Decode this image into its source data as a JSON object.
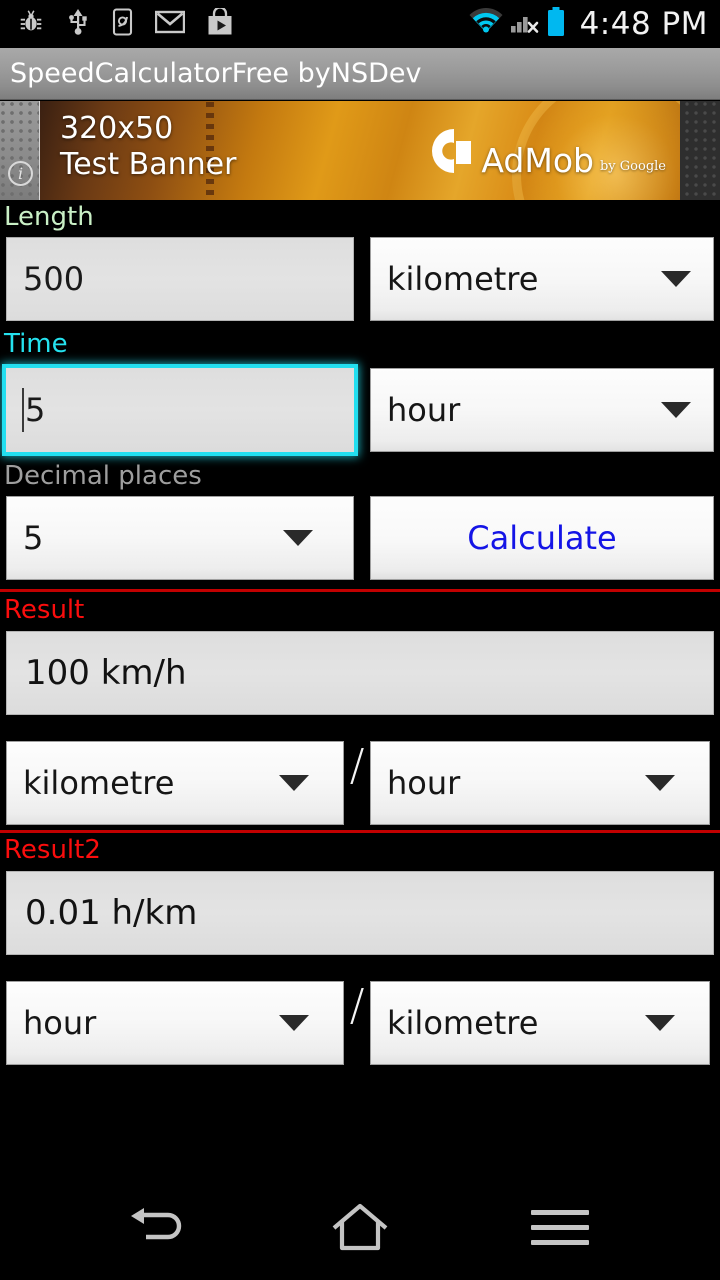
{
  "status_bar": {
    "icons": [
      "bug-icon",
      "usb-icon",
      "screen-cast-icon",
      "gmail-icon",
      "play-store-icon"
    ],
    "right_icons": [
      "wifi-icon",
      "cell-signal-no-sim-icon",
      "battery-icon"
    ],
    "clock": "4:48 PM",
    "wifi_color": "#00c8f0",
    "battery_color": "#00b8f0"
  },
  "title_bar": {
    "title": "SpeedCalculatorFree byNSDev"
  },
  "ad": {
    "info_glyph": "i",
    "line1": "320x50",
    "line2": "Test Banner",
    "brand": "AdMob",
    "brand_by": "by Google"
  },
  "form": {
    "length": {
      "label": "Length",
      "label_color": "#c9efc5",
      "value": "500",
      "unit": "kilometre"
    },
    "time": {
      "label": "Time",
      "label_color": "#25e2ef",
      "value": "5",
      "unit": "hour",
      "focused": true
    },
    "decimal": {
      "label": "Decimal places",
      "label_color": "#9e9e9e",
      "value": "5"
    },
    "calculate_label": "Calculate"
  },
  "result1": {
    "label": "Result",
    "label_color": "#fb0d0d",
    "value": "100 km/h",
    "numerator_unit": "kilometre",
    "denominator_unit": "hour",
    "separator": "/"
  },
  "result2": {
    "label": "Result2",
    "label_color": "#fb0d0d",
    "value": "0.01 h/km",
    "numerator_unit": "hour",
    "denominator_unit": "kilometre",
    "separator": "/"
  },
  "nav_bar": {
    "back": "back-icon",
    "home": "home-icon",
    "menu": "menu-icon"
  }
}
